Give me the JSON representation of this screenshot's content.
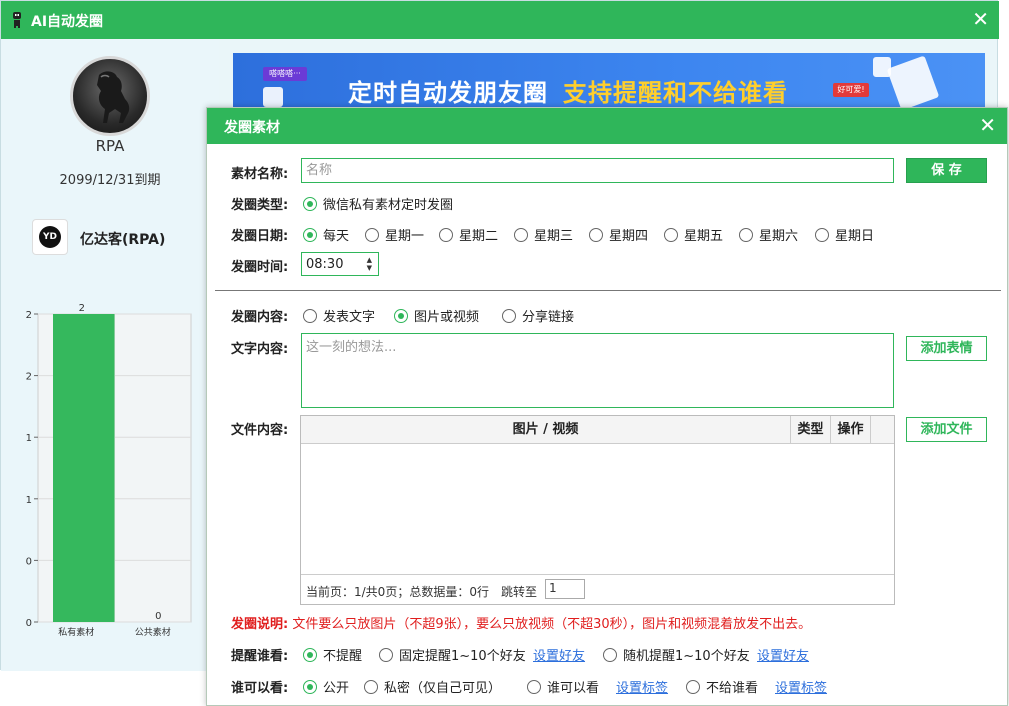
{
  "app": {
    "title": "AI自动发圈",
    "close": "✕"
  },
  "profile": {
    "name": "RPA",
    "expire": "2099/12/31到期",
    "company": "亿达客(RPA)",
    "company_logo_text": "YD"
  },
  "banner": {
    "text_main": "定时自动发朋友圈",
    "text_highlight": "支持提醒和不给谁看",
    "tag_left": "嗒嗒嗒···",
    "tag_right": "好可爱!"
  },
  "chart_data": {
    "type": "bar",
    "categories": [
      "私有素材",
      "公共素材"
    ],
    "values": [
      2,
      0
    ],
    "data_labels": [
      "2",
      "0"
    ],
    "y_tick_labels": [
      "2",
      "2",
      "1",
      "1",
      "0",
      "0"
    ],
    "ylim": [
      0,
      2
    ],
    "grid": true,
    "bar_color": "#35b85d"
  },
  "dialog": {
    "title": "发圈素材",
    "close": "✕",
    "name_label": "素材名称:",
    "name_placeholder": "名称",
    "save_button": "保 存",
    "type_label": "发圈类型:",
    "type_option": "微信私有素材定时发圈",
    "date_label": "发圈日期:",
    "date_options": [
      "每天",
      "星期一",
      "星期二",
      "星期三",
      "星期四",
      "星期五",
      "星期六",
      "星期日"
    ],
    "date_selected": "每天",
    "time_label": "发圈时间:",
    "time_value": "08:30",
    "content_label": "发圈内容:",
    "content_options": [
      "发表文字",
      "图片或视频",
      "分享链接"
    ],
    "content_selected": "图片或视频",
    "text_label": "文字内容:",
    "text_placeholder": "这一刻的想法...",
    "add_emoji_button": "添加表情",
    "file_label": "文件内容:",
    "add_file_button": "添加文件",
    "table": {
      "headers": [
        "图片 / 视频",
        "类型",
        "操作"
      ],
      "pagination": "当前页：1/共0页；总数据量：0行",
      "jump_label": "跳转至",
      "page_value": "1"
    },
    "note_label": "发圈说明:",
    "note_text": "文件要么只放图片（不超9张），要么只放视频（不超30秒），图片和视频混着放发不出去。",
    "remind_label": "提醒谁看:",
    "remind_options": [
      "不提醒",
      "固定提醒1~10个好友",
      "随机提醒1~10个好友"
    ],
    "remind_selected": "不提醒",
    "remind_link": "设置好友",
    "visible_label": "谁可以看:",
    "visible_options": [
      "公开",
      "私密（仅自己可见）",
      "谁可以看",
      "不给谁看"
    ],
    "visible_selected": "公开",
    "visible_link": "设置标签"
  }
}
